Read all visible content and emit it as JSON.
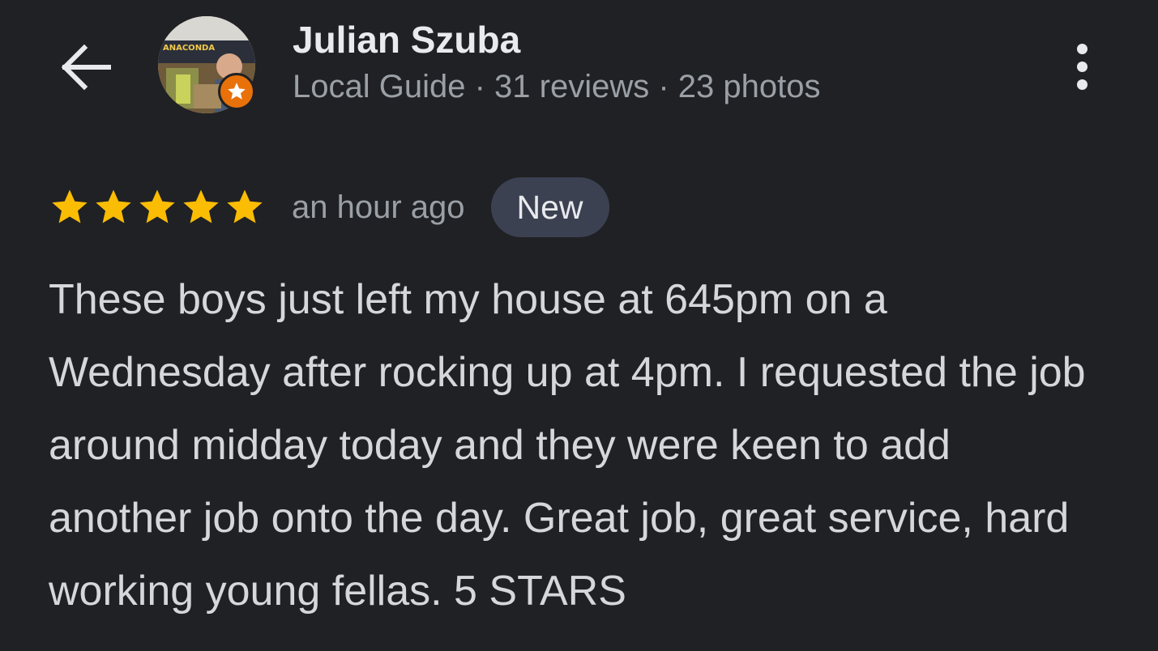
{
  "header": {
    "back_icon": "arrow-left-icon",
    "more_icon": "more-vertical-icon"
  },
  "reviewer": {
    "name": "Julian Szuba",
    "meta": "Local Guide · 31 reviews · 23 photos",
    "avatar_sign_text": "ANACONDA",
    "badge_icon": "star-icon",
    "badge_color": "#e8710a"
  },
  "review": {
    "stars": 5,
    "max_stars": 5,
    "star_color": "#fbbc04",
    "time_ago": "an hour ago",
    "badge_label": "New",
    "text": "These boys just left my house at 645pm on a Wednesday after rocking up at 4pm. I requested the job around midday today and they were keen to add another job onto the day. Great job, great service, hard working young fellas. 5 STARS"
  }
}
